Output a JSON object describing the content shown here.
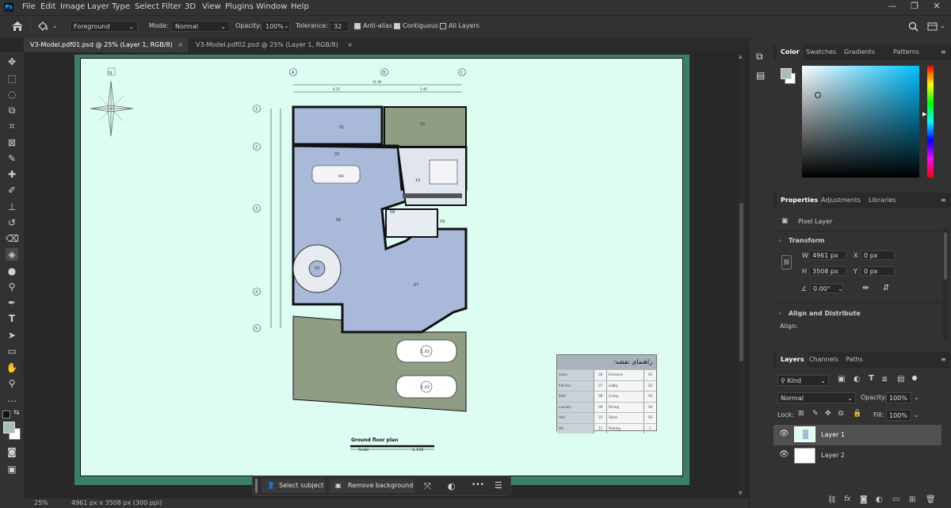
{
  "app": {
    "logo": "Ps"
  },
  "menu": [
    "File",
    "Edit",
    "Image",
    "Layer",
    "Type",
    "Select",
    "Filter",
    "3D",
    "View",
    "Plugins",
    "Window",
    "Help"
  ],
  "options": {
    "fill_source": "Foreground",
    "mode_label": "Mode:",
    "mode_value": "Normal",
    "opacity_label": "Opacity:",
    "opacity_value": "100%",
    "tolerance_label": "Tolerance:",
    "tolerance_value": "32",
    "antialias_label": "Anti-alias",
    "contiguous_label": "Contiguous",
    "all_layers_label": "All Layers"
  },
  "tabs": [
    {
      "label": "V3-Model.pdf01.psd @ 25% (Layer 1, RGB/8)",
      "close": "×"
    },
    {
      "label": "V3-Model.pdf02.psd @ 25% (Layer 1, RGB/8)",
      "close": "×"
    }
  ],
  "drawing": {
    "plan_title": "Ground floor plan",
    "scale_label": "Scale",
    "scale_value": "1:100",
    "north": "N",
    "grid_cols": [
      "A",
      "B",
      "C"
    ],
    "grid_rows": [
      "1",
      "2",
      "3",
      "4",
      "5"
    ],
    "dims_top": [
      "11.00",
      "6.15",
      "5.40"
    ],
    "parking_tags": [
      "C.01",
      "C.02"
    ],
    "room_tags": [
      "01",
      "02",
      "03",
      "04",
      "05",
      "06",
      "07",
      "08",
      "09",
      "10"
    ],
    "legend_title": "راهنمای نقشه:",
    "legend_rows": [
      {
        "left_name": "Salon",
        "left_no": "06",
        "right_name": "Entrance",
        "right_no": "01"
      },
      {
        "left_name": "Kitchen",
        "left_no": "07",
        "right_name": "Lobby",
        "right_no": "02"
      },
      {
        "left_name": "Bath",
        "left_no": "08",
        "right_name": "Living",
        "right_no": "03"
      },
      {
        "left_name": "Laundry",
        "left_no": "09",
        "right_name": "Dining",
        "right_no": "04"
      },
      {
        "left_name": "Hall",
        "left_no": "10",
        "right_name": "Stairs",
        "right_no": "05"
      },
      {
        "left_name": "WC",
        "left_no": "11",
        "right_name": "Parking",
        "right_no": "C"
      }
    ]
  },
  "status": {
    "zoom": "25%",
    "doc_info": "4961 px x 3508 px (300 ppi)"
  },
  "context_bar": {
    "select_subject": "Select subject",
    "remove_background": "Remove background",
    "more": "•••"
  },
  "color_panel": {
    "tabs": [
      "Color",
      "Swatches",
      "Gradients",
      "Patterns"
    ],
    "colors": {
      "foreground": "#a8bebb",
      "background": "#ffffff",
      "hue": "#00bfff"
    }
  },
  "properties_panel": {
    "tabs": [
      "Properties",
      "Adjustments",
      "Libraries"
    ],
    "layer_type": "Pixel Layer",
    "transform_title": "Transform",
    "w_label": "W",
    "w_value": "4961 px",
    "h_label": "H",
    "h_value": "3508 px",
    "x_label": "X",
    "x_value": "0 px",
    "y_label": "Y",
    "y_value": "0 px",
    "angle_value": "0.00°",
    "align_title": "Align and Distribute",
    "align_label": "Align:"
  },
  "layers_panel": {
    "tabs": [
      "Layers",
      "Channels",
      "Paths"
    ],
    "kind_label": "Kind",
    "blend_mode": "Normal",
    "opacity_label": "Opacity:",
    "opacity_value": "100%",
    "lock_label": "Lock:",
    "fill_label": "Fill:",
    "fill_value": "100%",
    "layers": [
      {
        "name": "Layer 1",
        "selected": true
      },
      {
        "name": "Layer 2",
        "selected": false
      }
    ],
    "footer_icons": [
      "link-icon",
      "fx-icon",
      "mask-icon",
      "adjustment-icon",
      "group-icon",
      "new-layer-icon",
      "trash-icon"
    ]
  }
}
